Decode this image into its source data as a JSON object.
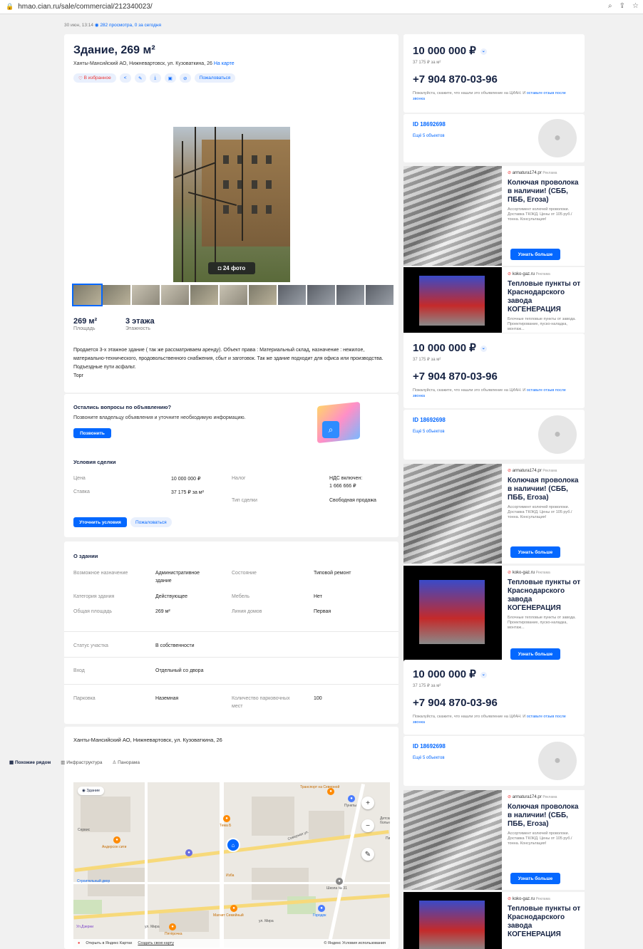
{
  "browser": {
    "url": "hmao.cian.ru/sale/commercial/212340023/"
  },
  "meta": {
    "date": "30 июн, 13:14",
    "views": "282 просмотра, 0 за сегодня"
  },
  "listing": {
    "title": "Здание, 269 м²",
    "address": "Ханты-Мансийский АО, Нижневартовск, ул. Кузоваткина, 26",
    "map_link": "На карте",
    "fav_label": "В избранное",
    "complain_label": "Пожаловаться",
    "photo_count": "24 фото",
    "area_value": "269 м²",
    "area_label": "Площадь",
    "floors_value": "3 этажа",
    "floors_label": "Этажность",
    "description": [
      "Продается 3-х этажное здание ( так же рассматриваем аренду). Объект права : Материальный склад, назначение : нежилое, материально-технического, продовольственного снабжения, сбыт и заготовок. Так же здание подходит для офиса или производства.",
      "Подъездные пути асфальт.",
      "Торг"
    ]
  },
  "questions": {
    "title": "Остались вопросы по объявлению?",
    "text": "Позвоните владельцу объявления и уточните необходимую информацию.",
    "button": "Позвонить"
  },
  "deal": {
    "title": "Условия сделки",
    "price_label": "Цена",
    "price_value": "10 000 000 ₽",
    "rate_label": "Ставка",
    "rate_value": "37 175 ₽ за м²",
    "tax_label": "Налог",
    "tax_value_1": "НДС включен:",
    "tax_value_2": "1 666 666 ₽",
    "type_label": "Тип сделки",
    "type_value": "Свободная продажа",
    "clarify": "Уточнить условия",
    "complain": "Пожаловаться"
  },
  "building": {
    "title": "О здании",
    "purpose_label": "Возможное назначение",
    "purpose_value_1": "Административное",
    "purpose_value_2": "здание",
    "state_label": "Состояние",
    "state_value": "Типовой ремонт",
    "cat_label": "Категория здания",
    "cat_value": "Действующее",
    "furn_label": "Мебель",
    "furn_value": "Нет",
    "total_label": "Общая площадь",
    "total_value": "269 м²",
    "line_label": "Линия домов",
    "line_value": "Первая",
    "status_label": "Статус участка",
    "status_value": "В собственности",
    "entry_label": "Вход",
    "entry_value": "Отдельный со двора",
    "park_label": "Парковка",
    "park_value": "Наземная",
    "pcount_label_1": "Количество парковочных",
    "pcount_label_2": "мест",
    "pcount_value": "100"
  },
  "map": {
    "address": "Ханты-Мансийский АО, Нижневартовск, ул. Кузоваткина, 26",
    "tab1": "Похожие рядом",
    "tab2": "Инфраструктура",
    "tab3": "Панорама",
    "chip": "Здание",
    "labels": [
      "Транспорт на Северной",
      "Пункты",
      "Детская больница",
      "Пи",
      "Тема Б",
      "Андерсон сити",
      "Северная ул.",
      "Изба",
      "Строительный двор",
      "Школа № 31",
      "Магнит Семейный",
      "Городок",
      "ул. Мира",
      "Пятёрочка",
      "Ул.Дзерни",
      "Сервис",
      "ул. Мира"
    ],
    "open_yandex": "Открыть в Яндекс Картах",
    "create_map": "Создать свою карту",
    "terms": "© Яндекс Условия использования"
  },
  "contact": {
    "price": "10 000 000 ₽",
    "ppm": "37 175 ₽ за м²",
    "phone": "+7 904 870-03-96",
    "note": "Пожалуйста, скажите, что нашли это объявление на ЦИАН. И ",
    "note_link": "оставьте отзыв после звонка",
    "id": "ID 18692698",
    "more": "Ещё 5 объектов"
  },
  "ads": [
    {
      "source": "armatura174.pr",
      "tag": "Реклама",
      "head": "Колючая проволока в наличии! (СББ, ПББ, Егоза)",
      "sub": "Ассортимент колючей проволоки. Доставка ТК/ЖД. Цены от 105 руб./тонна. Консультация!",
      "button": "Узнать больше"
    },
    {
      "source": "koko-gaz.ru",
      "tag": "Реклама",
      "head": "Тепловые пункты от Краснодарского завода КОГЕНЕРАЦИЯ",
      "sub": "Блочные тепловые пункты от завода. Проектирование, пуско-наладка, монтаж...",
      "button": "Узнать больше"
    }
  ],
  "colors": {
    "accent": "#0468ff",
    "text": "#152242",
    "bg": "#f1f1f1"
  }
}
